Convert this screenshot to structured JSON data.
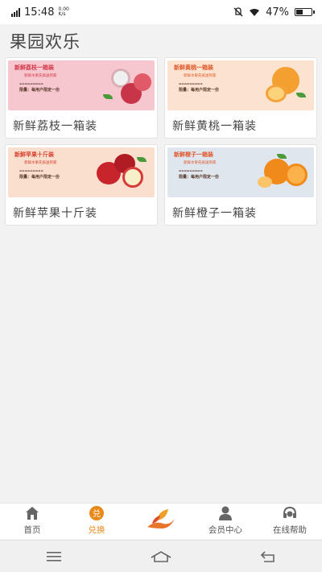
{
  "status_bar": {
    "time": "15:48",
    "net_speed_value": "0.00",
    "net_speed_unit": "K/s",
    "battery_percent": "47%",
    "battery_level": 0.47
  },
  "page": {
    "title": "果园欢乐"
  },
  "products": [
    {
      "title": "新鲜荔枝一箱装",
      "banner_headline": "新鲜荔枝一箱装",
      "banner_sub": "新鲜水果先疯送到家",
      "banner_limit": "限量：每用户限定一份",
      "colors": {
        "bg": "#f7c7cf",
        "headline": "#d23a4a",
        "fruit": "#e8a0a8"
      }
    },
    {
      "title": "新鲜黄桃一箱装",
      "banner_headline": "新鲜黄桃一箱装",
      "banner_sub": "新鲜水果先疯送到家",
      "banner_limit": "限量：每用户限定一份",
      "colors": {
        "bg": "#fbe3cf",
        "headline": "#e0572a",
        "fruit": "#f5a23a"
      }
    },
    {
      "title": "新鲜苹果十斤装",
      "banner_headline": "新鲜苹果十斤装",
      "banner_sub": "新鲜水果先疯送到家",
      "banner_limit": "限量：每用户限定一份",
      "colors": {
        "bg": "#fadfcf",
        "headline": "#d8402e",
        "fruit": "#c8242c"
      }
    },
    {
      "title": "新鲜橙子一箱装",
      "banner_headline": "新鲜橙子一箱装",
      "banner_sub": "新鲜水果先疯送到家",
      "banner_limit": "限量：每用户限定一份",
      "colors": {
        "bg": "#dfe6ee",
        "headline": "#e0572a",
        "fruit": "#f08a1a"
      }
    }
  ],
  "tabs": [
    {
      "label": "首页",
      "icon": "home-icon"
    },
    {
      "label": "兑换",
      "icon": "exchange-icon",
      "active": true
    },
    {
      "label": "",
      "icon": "hand-leaf-icon"
    },
    {
      "label": "会员中心",
      "icon": "member-icon"
    },
    {
      "label": "在线帮助",
      "icon": "help-icon"
    }
  ],
  "colors": {
    "accent": "#e88a1a"
  }
}
